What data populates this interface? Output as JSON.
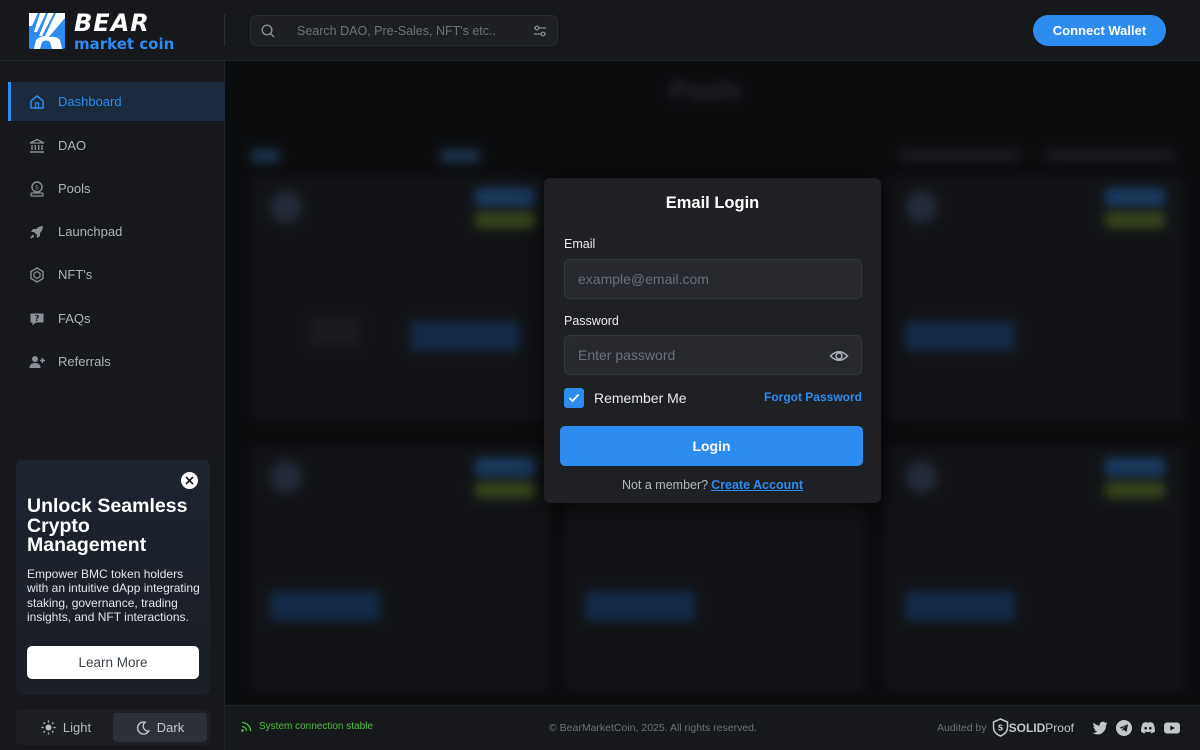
{
  "brand": {
    "title": "BEAR",
    "subtitle": "market coin"
  },
  "search": {
    "placeholder": "Search DAO, Pre-Sales, NFT's etc.."
  },
  "header": {
    "connect_label": "Connect Wallet"
  },
  "sidebar": {
    "items": [
      {
        "label": "Dashboard",
        "icon": "home-icon",
        "active": true
      },
      {
        "label": "DAO",
        "icon": "bank-icon"
      },
      {
        "label": "Pools",
        "icon": "coin-stack-icon"
      },
      {
        "label": "Launchpad",
        "icon": "rocket-icon"
      },
      {
        "label": "NFT's",
        "icon": "hexagon-icon"
      },
      {
        "label": "FAQs",
        "icon": "chat-question-icon"
      },
      {
        "label": "Referrals",
        "icon": "user-plus-icon"
      }
    ]
  },
  "promo": {
    "title": "Unlock Seamless Crypto Management",
    "text": "Empower BMC token holders with an intuitive dApp integrating staking, governance, trading insights, and NFT interactions.",
    "button": "Learn More"
  },
  "theme": {
    "light": "Light",
    "dark": "Dark",
    "selected": "dark"
  },
  "background": {
    "title": "Pools"
  },
  "modal": {
    "title": "Email Login",
    "email_label": "Email",
    "email_placeholder": "example@email.com",
    "password_label": "Password",
    "password_placeholder": "Enter password",
    "remember_label": "Remember Me",
    "remember_checked": true,
    "forgot_label": "Forgot Password",
    "login_label": "Login",
    "signup_prompt": "Not a member?",
    "signup_link": "Create Account"
  },
  "footer": {
    "status": "System connection stable",
    "copyright": "© BearMarketCoin, 2025. All rights reserved.",
    "audited_by": "Audited by",
    "auditor_a": "SOLID",
    "auditor_b": "Proof",
    "socials": [
      "twitter-icon",
      "telegram-icon",
      "discord-icon",
      "youtube-icon"
    ]
  },
  "colors": {
    "accent": "#2d8cf0",
    "status_ok": "#4fbf3f"
  }
}
